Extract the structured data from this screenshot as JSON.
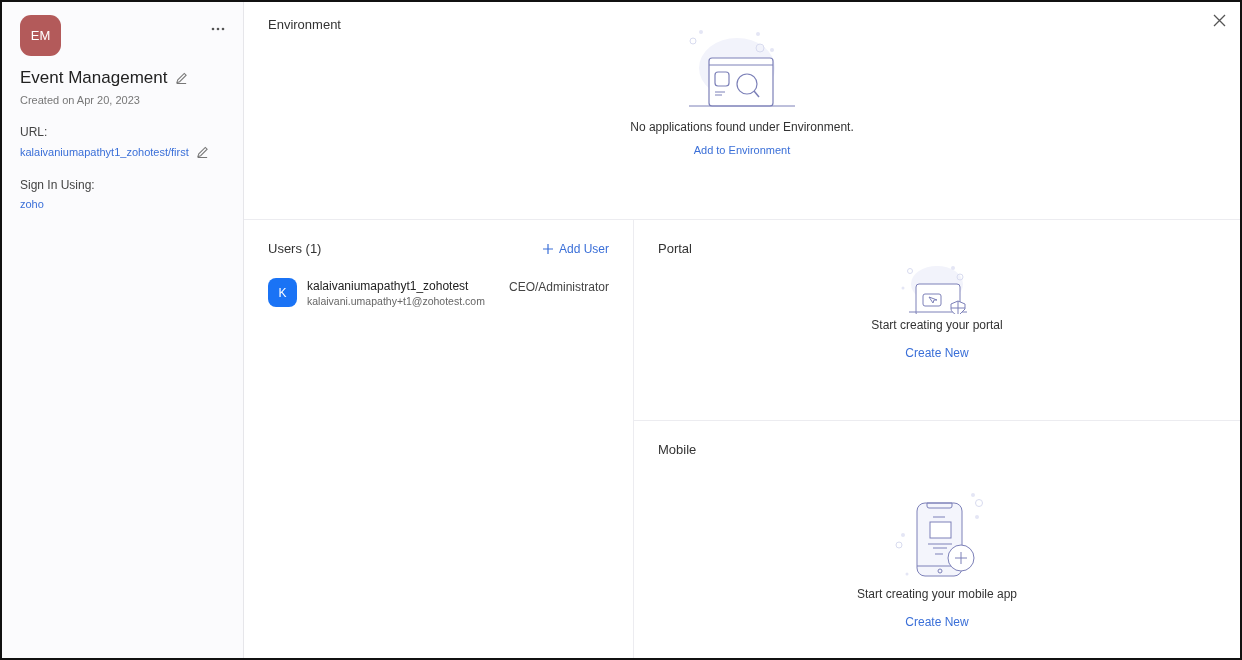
{
  "app": {
    "initials": "EM",
    "name": "Event Management",
    "created": "Created on Apr 20, 2023",
    "url_label": "URL:",
    "url": "kalaivaniumapathyt1_zohotest/first",
    "sign_in_label": "Sign In Using:",
    "sign_in": "zoho"
  },
  "environment": {
    "title": "Environment",
    "message": "No applications found under Environment.",
    "action": "Add to Environment"
  },
  "users": {
    "title": "Users (1)",
    "add": "Add User",
    "list": [
      {
        "initial": "K",
        "name": "kalaivaniumapathyt1_zohotest",
        "email": "kalaivani.umapathy+t1@zohotest.com",
        "role": "CEO/Administrator"
      }
    ]
  },
  "portal": {
    "title": "Portal",
    "message": "Start creating your portal",
    "action": "Create New"
  },
  "mobile": {
    "title": "Mobile",
    "message": "Start creating your mobile app",
    "action": "Create New"
  }
}
